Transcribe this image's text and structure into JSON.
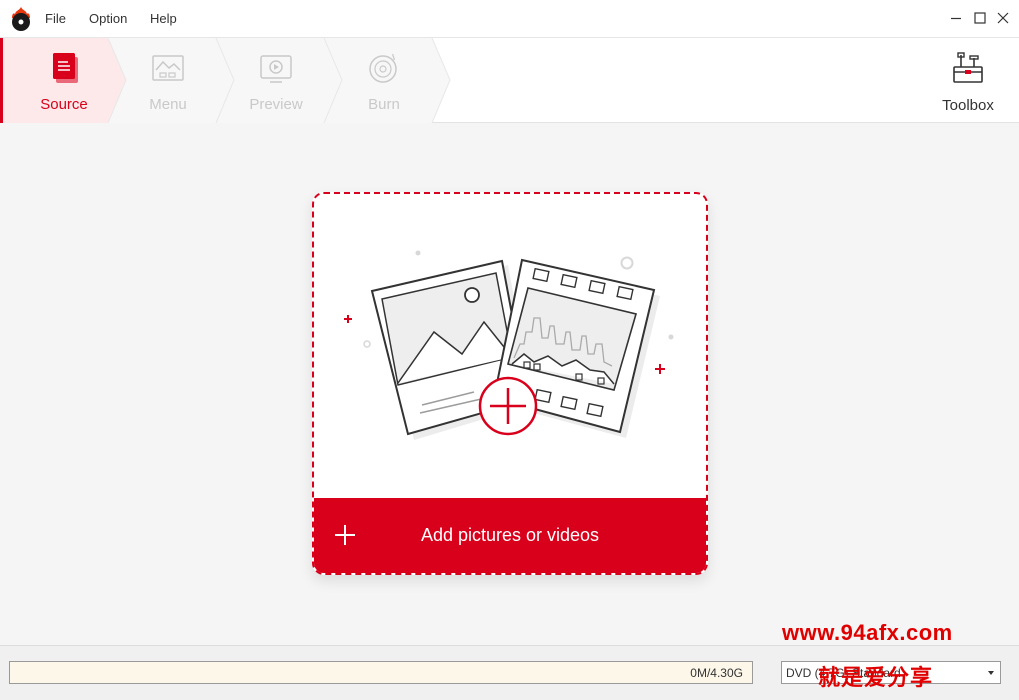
{
  "menu": {
    "file": "File",
    "option": "Option",
    "help": "Help"
  },
  "steps": [
    {
      "label": "Source",
      "icon": "source-document-icon",
      "active": true
    },
    {
      "label": "Menu",
      "icon": "menu-picture-icon",
      "active": false
    },
    {
      "label": "Preview",
      "icon": "preview-monitor-icon",
      "active": false
    },
    {
      "label": "Burn",
      "icon": "burn-disc-icon",
      "active": false
    }
  ],
  "toolbox": {
    "label": "Toolbox",
    "icon": "toolbox-icon"
  },
  "dropzone": {
    "add_label": "Add pictures or videos",
    "illustration": "photo-and-filmstrip-illustration"
  },
  "status": {
    "capacity_text": "0M/4.30G",
    "capacity_used_fraction": 0,
    "disc_value": "DVD (4.7G) Standard"
  },
  "watermark": {
    "url": "www.94afx.com",
    "text": "就是爱分享"
  },
  "colors": {
    "accent": "#d9001b",
    "active_step_bg": "#fde9ea",
    "inactive": "#c9c9c9"
  }
}
